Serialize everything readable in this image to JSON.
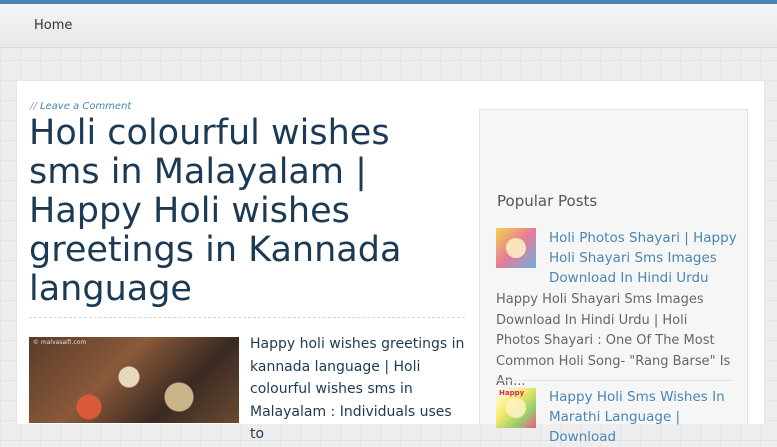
{
  "nav": {
    "home_label": "Home"
  },
  "post": {
    "meta_prefix": "//",
    "comment_link": "Leave a Comment",
    "title": "Holi colourful wishes sms in Malayalam | Happy Holi wishes greetings in Kannada language",
    "thumbnail_watermark": "© malvasaifi.com",
    "excerpt": "Happy holi wishes greetings in kannada language | Holi colourful wishes sms in Malayalam : Individuals uses to"
  },
  "sidebar": {
    "title": "Popular Posts",
    "posts": [
      {
        "title": "Holi Photos Shayari | Happy Holi Shayari Sms Images Download In Hindi Urdu",
        "excerpt": "Happy Holi Shayari Sms Images Download In Hindi Urdu | Holi Photos Shayari : One Of The Most Common Holi Song- \"Rang Barse\" Is An..."
      },
      {
        "title": "Happy Holi Sms Wishes In Marathi Language | Download",
        "thumb_text": "Happy"
      }
    ]
  },
  "colors": {
    "accent": "#4a86b5",
    "title_text": "#1c3a54",
    "sidebar_bg": "#f6f6f6"
  }
}
